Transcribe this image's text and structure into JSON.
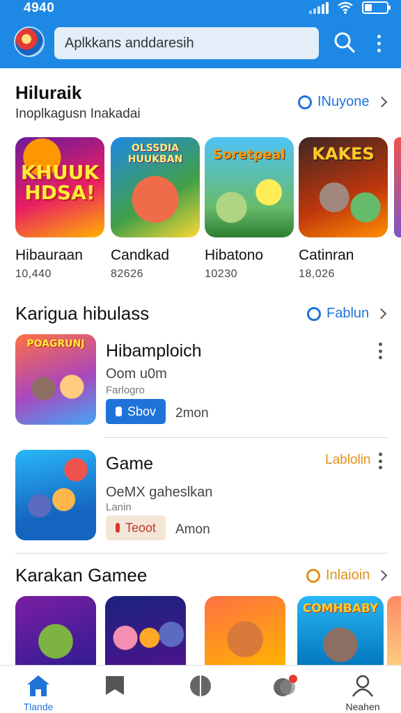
{
  "status_bar": {
    "time": "4940"
  },
  "header": {
    "search_placeholder": "Aplkkans anddaresih"
  },
  "featured": {
    "title": "Hiluraik",
    "subtitle": "Inoplkagusn Inakadai",
    "link": "INuyone",
    "cards": [
      {
        "name": "Hibauraan",
        "count": "10,440",
        "art_text": "KHUUK\nHDSA!"
      },
      {
        "name": "Candkad",
        "count": "82626",
        "art_text": "OLSSDIA\nHUUKBAN"
      },
      {
        "name": "Hibatono",
        "count": "10230",
        "art_text": "Soretpeal"
      },
      {
        "name": "Catinran",
        "count": "18,026",
        "art_text": "KAKES"
      }
    ]
  },
  "popular": {
    "title": "Karigua hibulass",
    "link": "Fablun",
    "items": [
      {
        "title": "Hibamploich",
        "subtitle": "Oom u0m",
        "subtitle2": "Farlogro",
        "button_label": "Sbov",
        "meta": "2mon",
        "tag": "",
        "thumb_text": "POAGRUNJ"
      },
      {
        "title": "Game",
        "subtitle": "OeMX gaheslkan",
        "subtitle2": "Lanin",
        "button_label": "Teoot",
        "meta": "Amon",
        "tag": "Lablolin",
        "thumb_text": ""
      }
    ]
  },
  "games": {
    "title": "Karakan Gamee",
    "link": "Inlaioin",
    "cards": [
      {
        "art_text": ""
      },
      {
        "art_text": ""
      },
      {
        "art_text": ""
      },
      {
        "art_text": "COMHBABY"
      }
    ]
  },
  "bottom_nav": {
    "items": [
      {
        "label": "Tlande",
        "icon": "home-icon",
        "active": true
      },
      {
        "label": "",
        "icon": "bookmark-icon",
        "active": false
      },
      {
        "label": "",
        "icon": "half-circle-icon",
        "active": false
      },
      {
        "label": "",
        "icon": "notifications-icon",
        "active": false
      },
      {
        "label": "Neahen",
        "icon": "profile-icon",
        "active": false
      }
    ]
  },
  "colors": {
    "accent": "#1e88e5",
    "link_blue": "#1e73d9",
    "link_orange": "#e0901a"
  }
}
